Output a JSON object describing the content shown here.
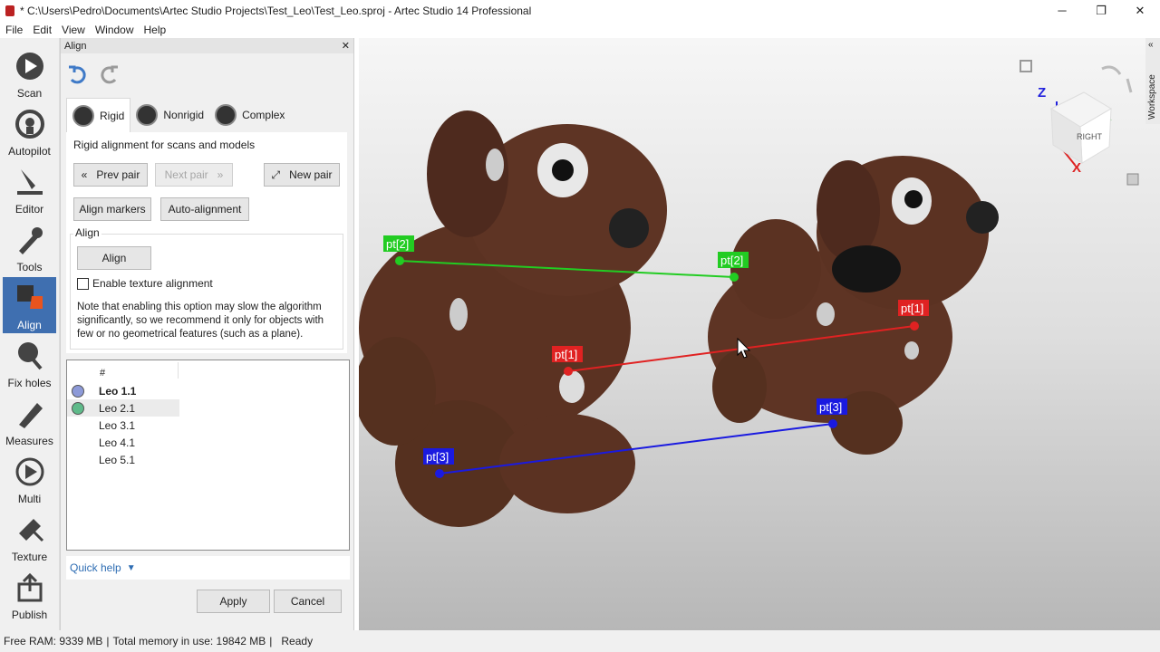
{
  "window": {
    "title": "* C:\\Users\\Pedro\\Documents\\Artec Studio Projects\\Test_Leo\\Test_Leo.sproj - Artec Studio 14 Professional",
    "minimize": "─",
    "restore": "❐",
    "close": "✕"
  },
  "menu": [
    "File",
    "Edit",
    "View",
    "Window",
    "Help"
  ],
  "toolbar": [
    {
      "label": "Scan",
      "icon": "scan-icon"
    },
    {
      "label": "Autopilot",
      "icon": "autopilot-icon"
    },
    {
      "label": "Editor",
      "icon": "editor-icon"
    },
    {
      "label": "Tools",
      "icon": "tools-icon"
    },
    {
      "label": "Align",
      "icon": "align-icon",
      "active": true
    },
    {
      "label": "Fix holes",
      "icon": "fix-holes-icon"
    },
    {
      "label": "Measures",
      "icon": "measures-icon"
    },
    {
      "label": "Multi",
      "icon": "multi-icon"
    },
    {
      "label": "Texture",
      "icon": "texture-icon"
    },
    {
      "label": "Publish",
      "icon": "publish-icon"
    }
  ],
  "panel": {
    "title": "Align",
    "close": "✕",
    "tabs": [
      "Rigid",
      "Nonrigid",
      "Complex"
    ],
    "subtitle": "Rigid alignment for scans and models",
    "prev_pair": "Prev pair",
    "next_pair": "Next pair",
    "new_pair": "New pair",
    "align_markers": "Align markers",
    "auto_alignment": "Auto-alignment",
    "group_label": "Align",
    "align_button": "Align",
    "texture_checkbox": "Enable texture alignment",
    "note": "Note that enabling this option may slow the algorithm significantly, so we recommend it only for objects with few or no geometrical features (such as a plane).",
    "list_header": "#",
    "list": [
      {
        "name": "Leo 1.1",
        "bold": true,
        "color": "#8d9ad8"
      },
      {
        "name": "Leo 2.1",
        "selected": true,
        "color": "#5fba8a"
      },
      {
        "name": "Leo 3.1"
      },
      {
        "name": "Leo 4.1"
      },
      {
        "name": "Leo 5.1"
      }
    ],
    "quick_help": "Quick help",
    "apply": "Apply",
    "cancel": "Cancel"
  },
  "viewport": {
    "points": [
      "pt[2]",
      "pt[2]",
      "pt[1]",
      "pt[1]",
      "pt[3]",
      "pt[3]"
    ],
    "axis_z": "Z",
    "axis_x": "X",
    "cube_face": "RIGHT",
    "workspace": "Workspace",
    "colors": {
      "pt2": "#22cc22",
      "pt1": "#e02222",
      "pt3": "#1a1ae0"
    }
  },
  "status": {
    "free_ram": "Free RAM: 9339 MB",
    "total_memory": "Total memory in use: 19842 MB",
    "state": "Ready"
  }
}
